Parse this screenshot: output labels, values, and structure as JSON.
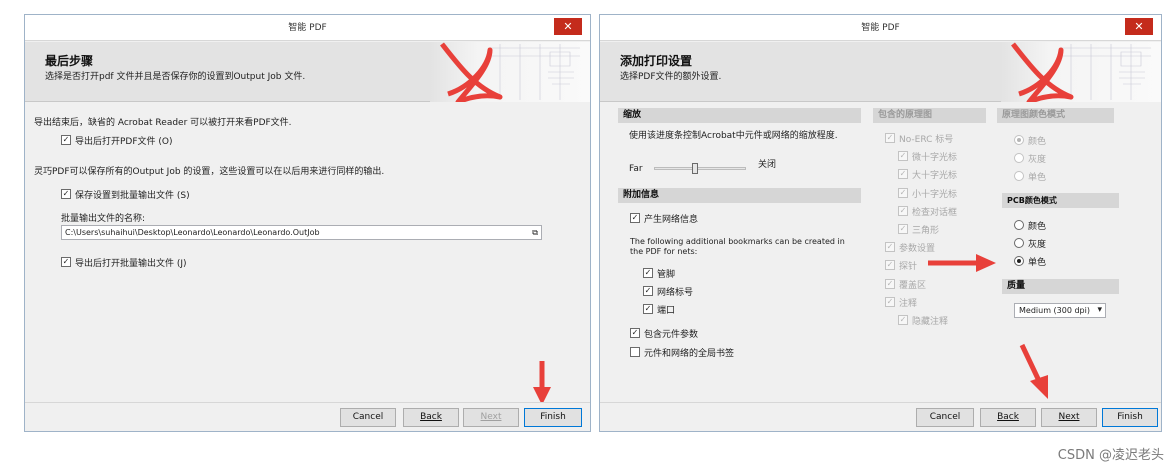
{
  "left": {
    "title": "智能 PDF",
    "close_label": "✕",
    "header_title": "最后步骤",
    "header_sub": "选择是否打开pdf 文件并且是否保存你的设置到Output Job 文件.",
    "text1": "导出结束后，缺省的 Acrobat Reader 可以被打开来看PDF文件.",
    "cb1_label": "导出后打开PDF文件 (O)",
    "cb1_checked": "✓",
    "text2": "灵巧PDF可以保存所有的Output Job 的设置，这些设置可以在以后用来进行同样的输出.",
    "cb2_label": "保存设置到批量输出文件 (S)",
    "cb2_checked": "✓",
    "file_label": "批量输出文件的名称:",
    "file_value": "C:\\Users\\suhaihui\\Desktop\\Leonardo\\Leonardo\\Leonardo.OutJob",
    "cb3_label": "导出后打开批量输出文件 (J)",
    "cb3_checked": "✓",
    "buttons": {
      "cancel": "Cancel",
      "back": "Back",
      "next": "Next",
      "finish": "Finish"
    }
  },
  "right": {
    "title": "智能 PDF",
    "close_label": "✕",
    "header_title": "添加打印设置",
    "header_sub": "选择PDF文件的额外设置.",
    "zoom_section": "缩放",
    "zoom_text": "使用该进度条控制Acrobat中元件或网络的缩放程度.",
    "zoom_far": "Far",
    "zoom_close": "关闭",
    "zoom_level": 0.45,
    "extra_section": "附加信息",
    "gen_net_info": "产生网络信息",
    "bookmarks_text": "The following additional bookmarks can be created in the PDF for nets:",
    "pins": "管脚",
    "net_labels": "网络标号",
    "ports": "端口",
    "include_params": "包含元件参数",
    "global_bookmarks": "元件和网络的全局书签",
    "check": "✓",
    "schematic_section": "包含的原理图",
    "schematic_items": [
      "No-ERC 标号",
      "微十字光标",
      "大十字光标",
      "小十字光标",
      "检查对话框",
      "三角形",
      "参数设置",
      "探针",
      "覆盖区",
      "注释",
      "隐藏注释"
    ],
    "sch_color_section": "原理图颜色模式",
    "sch_color_options": [
      "颜色",
      "灰度",
      "单色"
    ],
    "pcb_color_section": "PCB颜色模式",
    "pcb_color_options": [
      "颜色",
      "灰度",
      "单色"
    ],
    "quality_section": "质量",
    "quality_value": "Medium (300 dpi)",
    "buttons": {
      "cancel": "Cancel",
      "back": "Back",
      "next": "Next",
      "finish": "Finish"
    }
  },
  "watermark": "CSDN @凌迟老头",
  "colors": {
    "arrow": "#e8403a",
    "close": "#c42b1c",
    "accent": "#0078d7"
  }
}
